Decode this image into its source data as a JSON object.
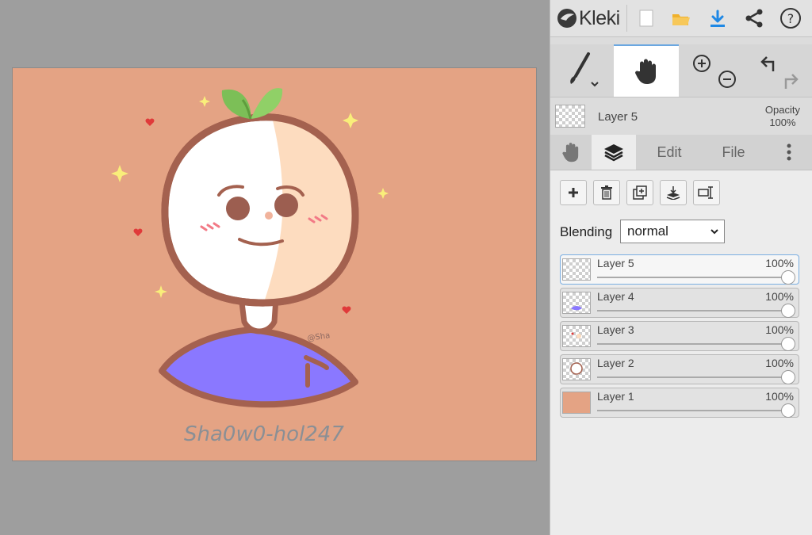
{
  "app": {
    "title": "Kleki"
  },
  "canvas": {
    "background_color": "#e4a384",
    "signature": "Sha0w0-hol247",
    "watermark": "@Sha"
  },
  "topbar": {
    "icons": [
      "new-image-icon",
      "open-folder-icon",
      "download-icon",
      "share-icon",
      "help-icon"
    ]
  },
  "tools": {
    "active": "hand",
    "items": [
      "brush-icon",
      "hand-icon",
      "zoom-in-icon",
      "zoom-out-icon",
      "undo-icon",
      "redo-icon"
    ]
  },
  "current_layer": {
    "name": "Layer 5",
    "opacity_label": "Opacity",
    "opacity_value": "100%"
  },
  "tabs": {
    "active": "layers",
    "edit": "Edit",
    "file": "File"
  },
  "layer_actions": [
    "add-layer-icon",
    "delete-layer-icon",
    "duplicate-layer-icon",
    "merge-down-icon",
    "rename-layer-icon"
  ],
  "blending": {
    "label": "Blending",
    "value": "normal"
  },
  "layers": [
    {
      "name": "Layer 5",
      "opacity": "100%",
      "active": true
    },
    {
      "name": "Layer 4",
      "opacity": "100%",
      "active": false
    },
    {
      "name": "Layer 3",
      "opacity": "100%",
      "active": false
    },
    {
      "name": "Layer 2",
      "opacity": "100%",
      "active": false
    },
    {
      "name": "Layer 1",
      "opacity": "100%",
      "active": false
    }
  ],
  "colors": {
    "accent": "#1e88e5",
    "active_border": "#7aaee2",
    "panel": "#ececec"
  }
}
